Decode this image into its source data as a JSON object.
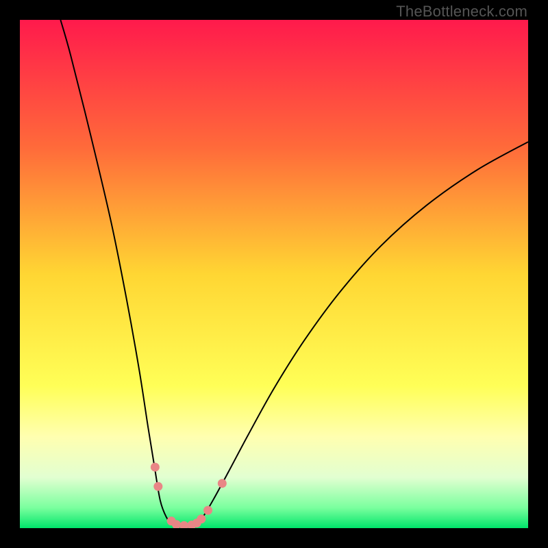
{
  "watermark": "TheBottleneck.com",
  "chart_data": {
    "type": "line",
    "title": "",
    "xlabel": "",
    "ylabel": "",
    "xlim": [
      0,
      100
    ],
    "ylim": [
      0,
      100
    ],
    "background_gradient": {
      "type": "vertical",
      "stops": [
        {
          "pos": 0.0,
          "color": "#ff1a4c"
        },
        {
          "pos": 0.25,
          "color": "#ff6a3a"
        },
        {
          "pos": 0.5,
          "color": "#ffd633"
        },
        {
          "pos": 0.72,
          "color": "#ffff57"
        },
        {
          "pos": 0.82,
          "color": "#ffffb0"
        },
        {
          "pos": 0.9,
          "color": "#e2ffd1"
        },
        {
          "pos": 0.96,
          "color": "#7aff9e"
        },
        {
          "pos": 1.0,
          "color": "#00e56a"
        }
      ]
    },
    "series": [
      {
        "name": "curve",
        "stroke": "#000000",
        "stroke_width": 2,
        "points": [
          {
            "x": 8.0,
            "y": 100.0
          },
          {
            "x": 10.0,
            "y": 93.0
          },
          {
            "x": 14.0,
            "y": 77.0
          },
          {
            "x": 18.0,
            "y": 60.0
          },
          {
            "x": 21.0,
            "y": 45.0
          },
          {
            "x": 23.5,
            "y": 31.0
          },
          {
            "x": 25.2,
            "y": 20.0
          },
          {
            "x": 26.5,
            "y": 12.0
          },
          {
            "x": 27.6,
            "y": 5.5
          },
          {
            "x": 28.8,
            "y": 2.2
          },
          {
            "x": 30.0,
            "y": 0.8
          },
          {
            "x": 31.5,
            "y": 0.3
          },
          {
            "x": 33.0,
            "y": 0.3
          },
          {
            "x": 34.5,
            "y": 0.8
          },
          {
            "x": 36.0,
            "y": 2.2
          },
          {
            "x": 38.0,
            "y": 5.5
          },
          {
            "x": 41.0,
            "y": 11.0
          },
          {
            "x": 45.0,
            "y": 18.5
          },
          {
            "x": 50.0,
            "y": 27.5
          },
          {
            "x": 56.0,
            "y": 37.0
          },
          {
            "x": 63.0,
            "y": 46.5
          },
          {
            "x": 71.0,
            "y": 55.5
          },
          {
            "x": 80.0,
            "y": 63.5
          },
          {
            "x": 90.0,
            "y": 70.5
          },
          {
            "x": 100.0,
            "y": 76.0
          }
        ]
      },
      {
        "name": "markers",
        "type": "scatter",
        "fill": "#e98686",
        "radius": 6.5,
        "points": [
          {
            "x": 26.6,
            "y": 12.0
          },
          {
            "x": 27.2,
            "y": 8.2
          },
          {
            "x": 29.8,
            "y": 1.4
          },
          {
            "x": 30.8,
            "y": 0.7
          },
          {
            "x": 32.3,
            "y": 0.5
          },
          {
            "x": 33.8,
            "y": 0.6
          },
          {
            "x": 34.8,
            "y": 1.0
          },
          {
            "x": 35.7,
            "y": 1.8
          },
          {
            "x": 37.0,
            "y": 3.5
          },
          {
            "x": 39.8,
            "y": 8.8
          }
        ]
      }
    ]
  }
}
